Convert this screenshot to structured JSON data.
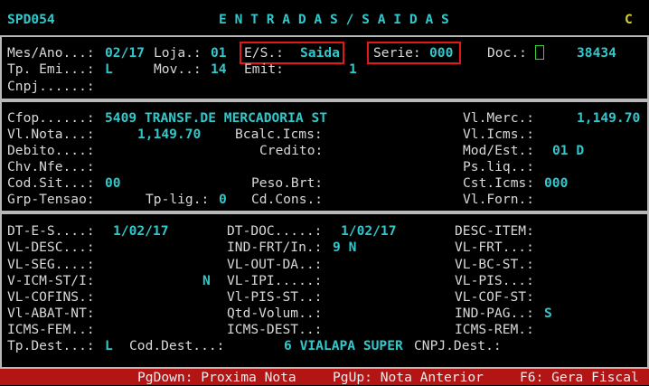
{
  "header": {
    "screen_id": "SPD054",
    "title": "E N T R A D A S / S A I D A S",
    "mode": "C"
  },
  "doc": {
    "mesano_lbl": "Mes/Ano...:",
    "mesano": "02/17",
    "loja_lbl": "Loja.:",
    "loja": "01",
    "es_lbl": "E/S.:",
    "es": "Saida",
    "serie_lbl": "Serie:",
    "serie": "000",
    "docnum_lbl": "Doc.:",
    "docnum": "38434",
    "tpemi_lbl": "Tp. Emi...:",
    "tpemi": "L",
    "mov_lbl": "Mov..:",
    "mov": "14",
    "emit_lbl": "Emit:",
    "emit": "1",
    "cnpj_lbl": "Cnpj......:"
  },
  "fiscal": {
    "cfop_lbl": "Cfop......:",
    "cfop": "5409 TRANSF.DE MERCADORIA ST",
    "vlmerc_lbl": "Vl.Merc.:",
    "vlmerc": "1,149.70",
    "vlnota_lbl": "Vl.Nota...:",
    "vlnota": "1,149.70",
    "bcalc_lbl": "Bcalc.Icms:",
    "vlicms_lbl": "Vl.Icms.:",
    "debito_lbl": "Debito....:",
    "credito_lbl": "Credito:",
    "modest_lbl": "Mod/Est.:",
    "modest": "01 D",
    "chvnfe_lbl": "Chv.Nfe...:",
    "psliq_lbl": "Ps.liq..:",
    "codsit_lbl": "Cod.Sit...:",
    "codsit": "00",
    "pesobrt_lbl": "Peso.Brt:",
    "csticms_lbl": "Cst.Icms:",
    "csticms": "000",
    "grptensao_lbl": "Grp-Tensao:",
    "tplig_lbl": "Tp-lig.:",
    "tplig": "0",
    "cdcons_lbl": "Cd.Cons.:",
    "vlforn_lbl": "Vl.Forn.:"
  },
  "detail": {
    "dtes_lbl": "DT-E-S....:",
    "dtes": "1/02/17",
    "dtdoc_lbl": "DT-DOC.....:",
    "dtdoc": "1/02/17",
    "descitem_lbl": "DESC-ITEM:",
    "vldesc_lbl": "VL-DESC...:",
    "indfrt_lbl": "IND-FRT/In.:",
    "indfrt": "9 N",
    "vlfrt_lbl": "VL-FRT...:",
    "vlseg_lbl": "VL-SEG....:",
    "vloutda_lbl": "VL-OUT-DA..:",
    "vlbcst_lbl": "VL-BC-ST.:",
    "vicmsst_lbl": "V-ICM-ST/I:",
    "vicmsst": "N",
    "vlipi_lbl": "VL-IPI.....:",
    "vlpis_lbl": "VL-PIS...:",
    "vlcofins_lbl": "VL-COFINS.:",
    "vlpisst_lbl": "Vl-PIS-ST..:",
    "vlcofst_lbl": "VL-COF-ST:",
    "vlabatnt_lbl": "Vl-ABAT-NT:",
    "qtdvolum_lbl": "Qtd-Volum..:",
    "indpag_lbl": "IND-PAG..:",
    "indpag": "S",
    "icmsfem_lbl": "ICMS-FEM..:",
    "icmsdest_lbl": "ICMS-DEST..:",
    "icmsrem_lbl": "ICMS-REM.:",
    "tpdest_lbl": "Tp.Dest...:",
    "tpdest": "L",
    "coddest_lbl": "Cod.Dest...:",
    "coddest": "6 VIALAPA SUPER",
    "cnpjdest_lbl": "CNPJ.Dest.:"
  },
  "status": {
    "pgdown": "PgDown: Proxima Nota",
    "pgup": "PgUp: Nota Anterior",
    "f6": "F6: Gera Fiscal"
  }
}
